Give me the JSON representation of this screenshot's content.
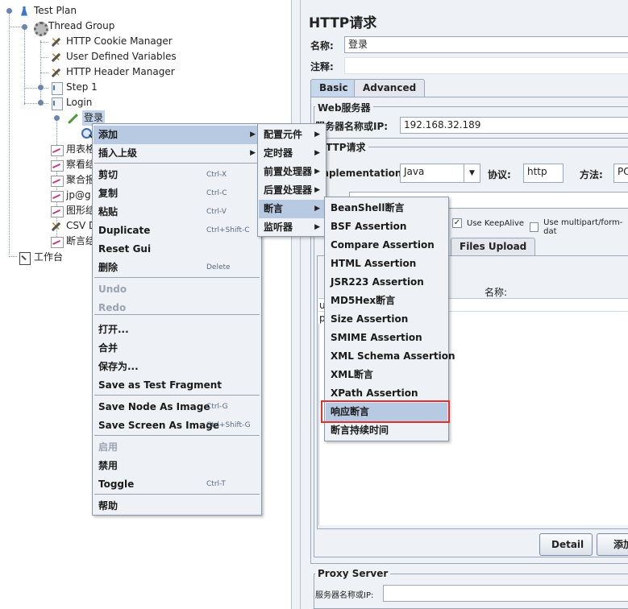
{
  "tree": {
    "test_plan": "Test Plan",
    "thread_group": "Thread Group",
    "cookie_manager": "HTTP Cookie Manager",
    "user_vars": "User Defined Variables",
    "header_manager": "HTTP Header Manager",
    "step1": "Step 1",
    "login": "Login",
    "login_sampler": "登录",
    "child_1": "用表格",
    "child_2": "察看结",
    "child_3": "聚合报",
    "child_4": "jp@g",
    "child_5": "图形结",
    "child_6": "CSV D",
    "child_7": "断言结",
    "workbench": "工作台"
  },
  "right": {
    "title": "HTTP请求",
    "name_label": "名称:",
    "name_value": "登录",
    "comment_label": "注释:",
    "tab_basic": "Basic",
    "tab_advanced": "Advanced",
    "web_server_group": "Web服务器",
    "server_label": "服务器名称或IP:",
    "server_value": "192.168.32.189",
    "http_request_group": "HTTP请求",
    "impl_label": "Implementation:",
    "impl_value": "Java",
    "protocol_label": "协议:",
    "protocol_value": "http",
    "method_label": "方法:",
    "method_value": "PO",
    "keepalive_label": "Use KeepAlive",
    "multipart_label": "Use multipart/form-dat",
    "files_upload_tab": "Files Upload",
    "name_col": "名称:",
    "row1": "u",
    "row2": "p",
    "detail_btn": "Detail",
    "add_btn": "添加",
    "proxy_group": "Proxy Server",
    "proxy_server_label": "服务器名称或IP:"
  },
  "menu_main": [
    {
      "label": "添加",
      "sub": true
    },
    {
      "label": "插入上级",
      "sub": true
    },
    {
      "label": "剪切",
      "shortcut": "Ctrl-X"
    },
    {
      "label": "复制",
      "shortcut": "Ctrl-C"
    },
    {
      "label": "粘贴",
      "shortcut": "Ctrl-V"
    },
    {
      "label": "Duplicate",
      "shortcut": "Ctrl+Shift-C"
    },
    {
      "label": "Reset Gui"
    },
    {
      "label": "删除",
      "shortcut": "Delete"
    },
    {
      "label": "Undo"
    },
    {
      "label": "Redo"
    },
    {
      "label": "打开..."
    },
    {
      "label": "合并"
    },
    {
      "label": "保存为..."
    },
    {
      "label": "Save as Test Fragment"
    },
    {
      "label": "Save Node As Image",
      "shortcut": "Ctrl-G"
    },
    {
      "label": "Save Screen As Image",
      "shortcut": "Ctrl+Shift-G"
    },
    {
      "label": "启用"
    },
    {
      "label": "禁用"
    },
    {
      "label": "Toggle",
      "shortcut": "Ctrl-T"
    },
    {
      "label": "帮助"
    }
  ],
  "menu_add": [
    "配置元件",
    "定时器",
    "前置处理器",
    "后置处理器",
    "断言",
    "监听器"
  ],
  "menu_assert": [
    "BeanShell断言",
    "BSF Assertion",
    "Compare Assertion",
    "HTML Assertion",
    "JSR223 Assertion",
    "MD5Hex断言",
    "Size Assertion",
    "SMIME Assertion",
    "XML Schema Assertion",
    "XML断言",
    "XPath Assertion",
    "响应断言",
    "断言持续时间"
  ],
  "colors": {
    "highlight": "#b8cae2",
    "callout": "#e03030",
    "selection": "#c2d4ec"
  }
}
